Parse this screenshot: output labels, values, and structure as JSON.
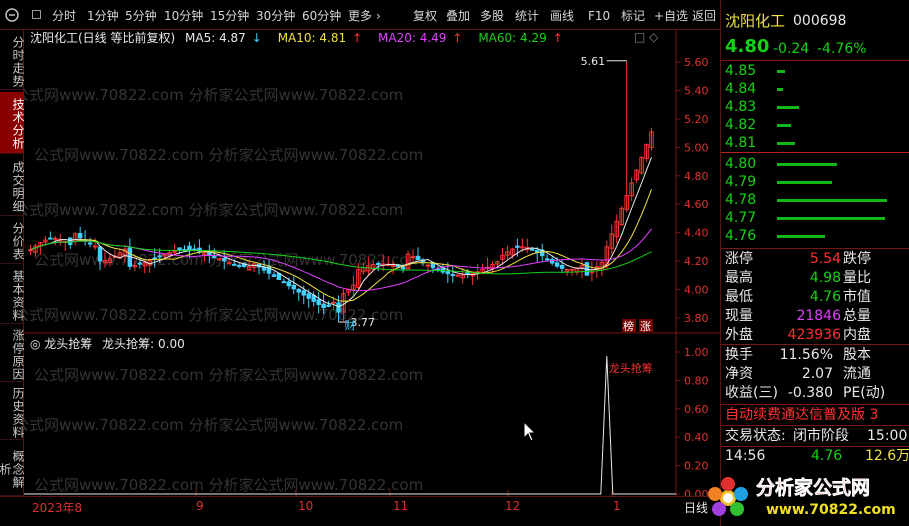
{
  "toolbar": {
    "periods": [
      "分时",
      "1分钟",
      "5分钟",
      "10分钟",
      "15分钟",
      "30分钟",
      "60分钟",
      "更多",
      "›"
    ],
    "actions": [
      "复权",
      "叠加",
      "多股",
      "统计",
      "画线",
      "F10",
      "标记",
      "+自选",
      "返回"
    ]
  },
  "left_tabs": [
    "分时走势",
    "技术分析",
    "成交明细",
    "分价表",
    "基本资料",
    "涨停原因",
    "历史资料",
    "概念解析"
  ],
  "main_header": {
    "title": "沈阳化工(日线 等比前复权)",
    "ma5": "MA5: 4.87",
    "ma5_arrow": "↓",
    "ma10": "MA10: 4.81",
    "ma10_arrow": "↑",
    "ma20": "MA20: 4.49",
    "ma20_arrow": "↑",
    "ma60": "MA60: 4.29",
    "ma60_arrow": "↑",
    "icons": "□ ◇"
  },
  "sub_header": {
    "name": "龙头抢筹",
    "value": "龙头抢筹: 0.00"
  },
  "watermark": "公式网www.70822.com 分析家公式网www.70822.com",
  "annotations": {
    "high": "5.61",
    "low": "3.77",
    "cai": "财",
    "bang": "榜",
    "zhang": "涨",
    "signal": "龙头抢筹"
  },
  "colors": {
    "up": "#ff3232",
    "down": "#40d0ff",
    "ma5": "#e8e8e8",
    "ma10": "#f0e040",
    "ma20": "#e040ff",
    "ma60": "#14d214",
    "grid": "#7a1515"
  },
  "chart_data": {
    "type": "candlestick",
    "y_axis_main": [
      "5.60",
      "5.40",
      "5.20",
      "5.00",
      "4.80",
      "4.60",
      "4.40",
      "4.20",
      "4.00",
      "3.80"
    ],
    "y_axis_sub": [
      "1.00",
      "0.80",
      "0.60",
      "0.40",
      "0.20",
      "0.00"
    ],
    "x_labels": [
      "2023年8",
      "9",
      "10",
      "11",
      "12",
      "1"
    ],
    "ylim_main": [
      3.7,
      5.7
    ],
    "ylim_sub": [
      0,
      1.0
    ]
  },
  "bottom": {
    "right_label": "日线"
  },
  "quote": {
    "name": "沈阳化工",
    "code": "000698",
    "price": "4.80",
    "change": "-0.24",
    "pct": "-4.76%",
    "asks": [
      {
        "p": "4.85",
        "w": 8
      },
      {
        "p": "4.84",
        "w": 6
      },
      {
        "p": "4.83",
        "w": 22
      },
      {
        "p": "4.82",
        "w": 14
      },
      {
        "p": "4.81",
        "w": 18
      }
    ],
    "bids": [
      {
        "p": "4.80",
        "w": 60
      },
      {
        "p": "4.79",
        "w": 55
      },
      {
        "p": "4.78",
        "w": 110
      },
      {
        "p": "4.77",
        "w": 108
      },
      {
        "p": "4.76",
        "w": 48
      }
    ],
    "stats_left": [
      {
        "label": "涨停",
        "value": "5.54",
        "cls": "red"
      },
      {
        "label": "最高",
        "value": "4.98",
        "cls": "green"
      },
      {
        "label": "最低",
        "value": "4.76",
        "cls": "green"
      },
      {
        "label": "现量",
        "value": "21846",
        "cls": "magenta"
      },
      {
        "label": "外盘",
        "value": "423936",
        "cls": "red"
      }
    ],
    "stats_right": [
      "跌停",
      "量比",
      "市值",
      "总量",
      "内盘"
    ],
    "stats2": [
      {
        "label": "换手",
        "value": "11.56%",
        "right": "股本"
      },
      {
        "label": "净资",
        "value": "2.07",
        "right": "流通"
      },
      {
        "label": "收益(三)",
        "value": "-0.380",
        "right": "PE(动)"
      }
    ],
    "ticker": "自动续费通达信普及版 3",
    "trade_status_label": "交易状态:",
    "trade_status": "闭市阶段",
    "trade_time": "15:00",
    "last_tick_time": "14:56",
    "last_tick_price": "4.76",
    "last_tick_vol": "12.6万"
  },
  "logo": {
    "text": "分析家公式网",
    "url": "www.70822.com"
  }
}
